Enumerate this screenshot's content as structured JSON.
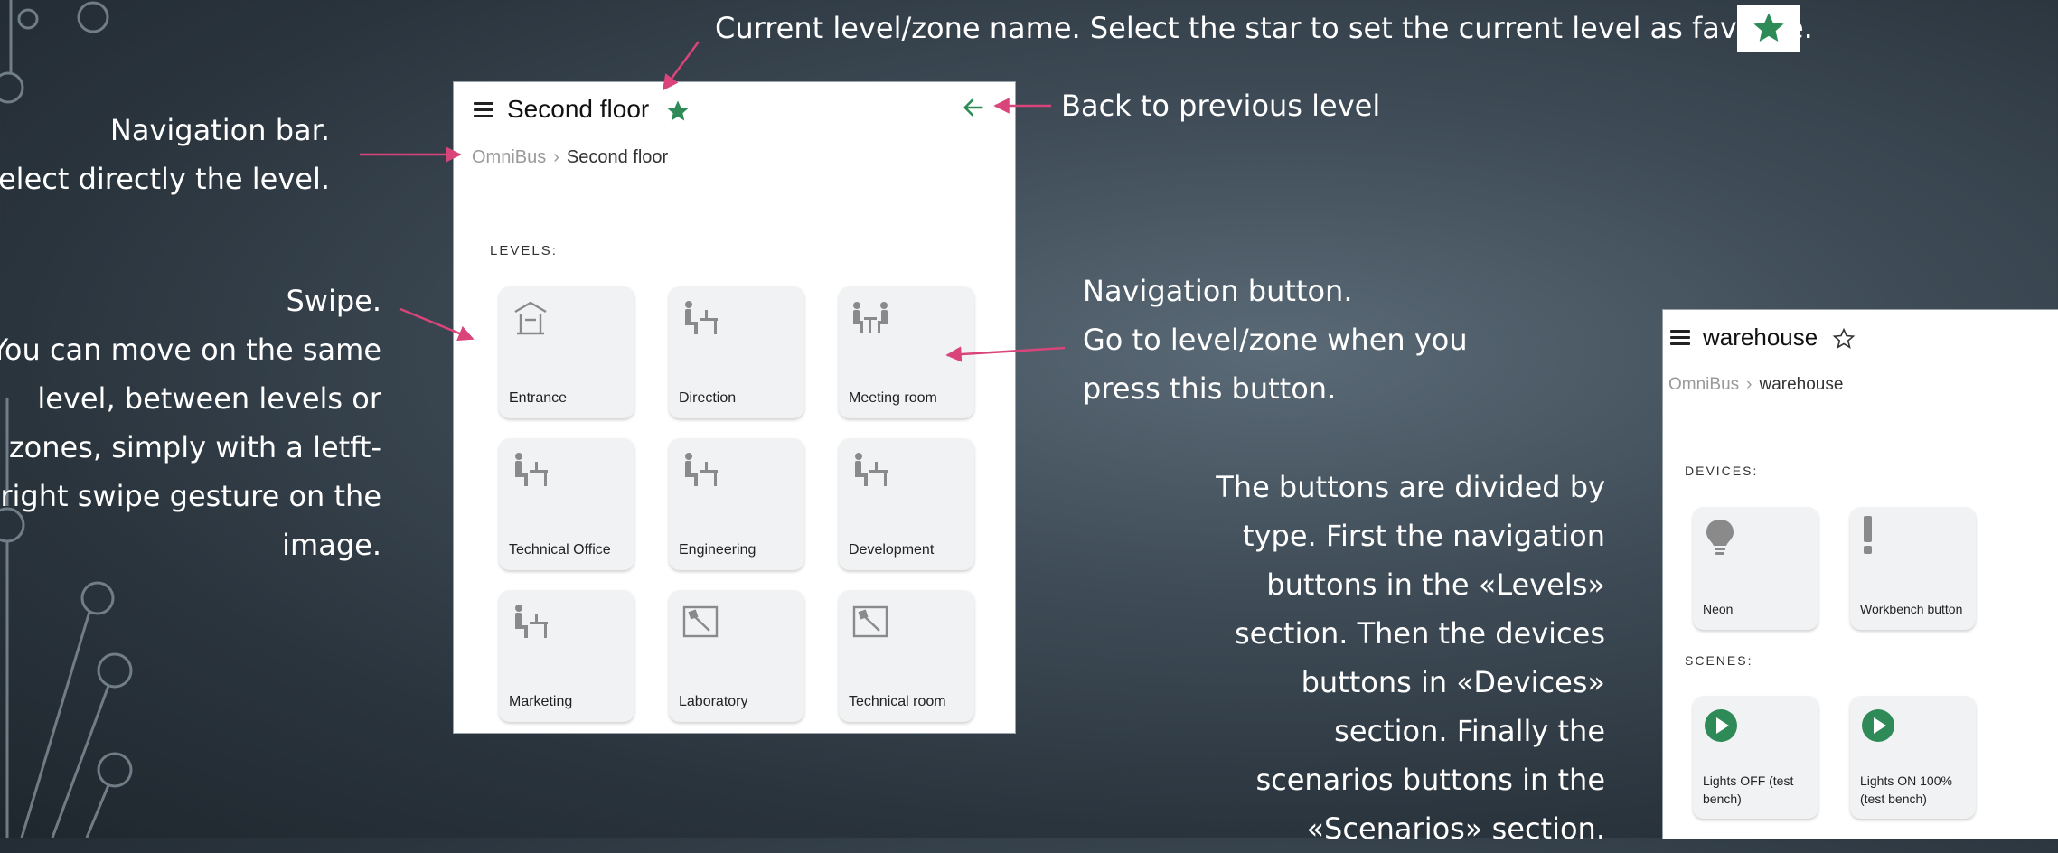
{
  "annotations": {
    "current_level": "Current level/zone name. Select the star to set the current level as favorite.",
    "back": "Back to previous level",
    "nav_bar": [
      "Navigation bar.",
      "Select directly the level."
    ],
    "swipe": [
      "Swipe.",
      "You can move on the same",
      "level, between levels or",
      "zones, simply with a letft-",
      "right swipe gesture on the",
      "image."
    ],
    "nav_button": [
      "Navigation button.",
      "Go to level/zone when you",
      "press this button."
    ],
    "buttons_divided": [
      "The buttons are divided by",
      "type. First the navigation",
      "buttons in the «Levels»",
      "section. Then the devices",
      "buttons in «Devices»",
      "section. Finally the",
      "scenarios buttons in the",
      "«Scenarios» section."
    ]
  },
  "panel_main": {
    "title": "Second floor",
    "breadcrumb": [
      "OmniBus",
      "Second floor"
    ],
    "section_label": "LEVELS:",
    "tiles": [
      {
        "label": "Entrance",
        "icon": "entrance-icon"
      },
      {
        "label": "Direction",
        "icon": "desk-person-icon"
      },
      {
        "label": "Meeting room",
        "icon": "meeting-icon"
      },
      {
        "label": "Technical Office",
        "icon": "desk-person-icon"
      },
      {
        "label": "Engineering",
        "icon": "desk-person-icon"
      },
      {
        "label": "Development",
        "icon": "desk-person-icon"
      },
      {
        "label": "Marketing",
        "icon": "desk-person-icon"
      },
      {
        "label": "Laboratory",
        "icon": "tool-icon"
      },
      {
        "label": "Technical room",
        "icon": "tool-icon"
      }
    ]
  },
  "panel_warehouse": {
    "title": "warehouse",
    "breadcrumb": [
      "OmniBus",
      "warehouse"
    ],
    "devices_label": "DEVICES:",
    "devices": [
      {
        "label": "Neon",
        "icon": "bulb-icon"
      },
      {
        "label": "Workbench button",
        "icon": "exclamation-icon"
      }
    ],
    "scenes_label": "SCENES:",
    "scenes": [
      {
        "label": "Lights OFF (test bench)",
        "icon": "play-icon"
      },
      {
        "label": "Lights ON 100% (test bench)",
        "icon": "play-icon"
      }
    ]
  },
  "colors": {
    "accent_green": "#2e8b57",
    "arrow_pink": "#d9457a",
    "tile_bg": "#f1f2f3",
    "icon_gray": "#8a8a8a"
  }
}
